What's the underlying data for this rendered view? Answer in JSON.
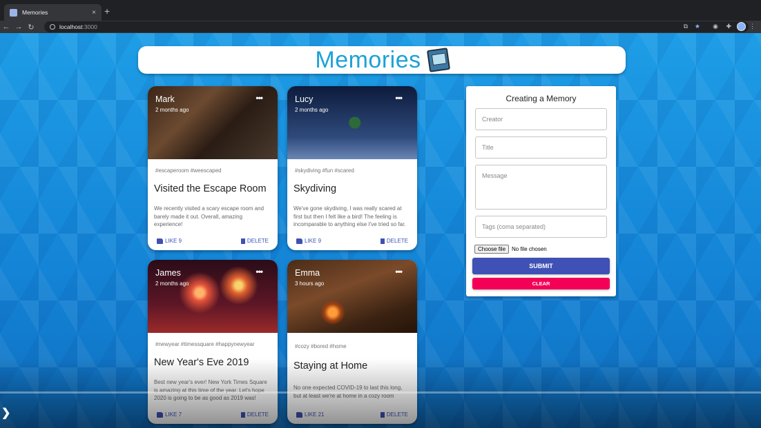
{
  "browser": {
    "tab_title": "Memories",
    "tab_close": "×",
    "new_tab": "+",
    "url_host": "localhost",
    "url_port": ":3000"
  },
  "app": {
    "title": "Memories"
  },
  "posts": [
    {
      "creator": "Mark",
      "time": "2 months ago",
      "tags": "#escaperoom #weescaped",
      "title": "Visited the Escape Room",
      "message": "We recently visited a scary escape room and barely made it out. Overall, amazing experience!",
      "like_label": "LIKE 9",
      "delete_label": "DELETE"
    },
    {
      "creator": "Lucy",
      "time": "2 months ago",
      "tags": "#skydiving #fun #scared",
      "title": "Skydiving",
      "message": "We've gone skydiving, I was really scared at first but then I felt like a bird! The feeling is incomparable to anything else I've tried so far.",
      "like_label": "LIKE 9",
      "delete_label": "DELETE"
    },
    {
      "creator": "James",
      "time": "2 months ago",
      "tags": "#newyear #timessquare #happynewyear",
      "title": "New Year's Eve 2019",
      "message": "Best new year's ever! New York Times Square is amazing at this time of the year. Let's hope 2020 is going to be as good as 2019 was!",
      "like_label": "LIKE 7",
      "delete_label": "DELETE"
    },
    {
      "creator": "Emma",
      "time": "3 hours ago",
      "tags": "#cozy #bored #home",
      "title": "Staying at Home",
      "message": "No one expected COVID-19 to last this long, but at least we're at home in a cozy room",
      "like_label": "LIKE 21",
      "delete_label": "DELETE"
    }
  ],
  "form": {
    "heading": "Creating a Memory",
    "creator_placeholder": "Creator",
    "title_placeholder": "Title",
    "message_placeholder": "Message",
    "tags_placeholder": "Tags (coma separated)",
    "choose_file": "Choose file",
    "no_file": "No file chosen",
    "submit": "SUBMIT",
    "clear": "CLEAR"
  },
  "colors": {
    "brand": "#1da1d8",
    "primary": "#3f51b5",
    "secondary": "#f50057"
  }
}
